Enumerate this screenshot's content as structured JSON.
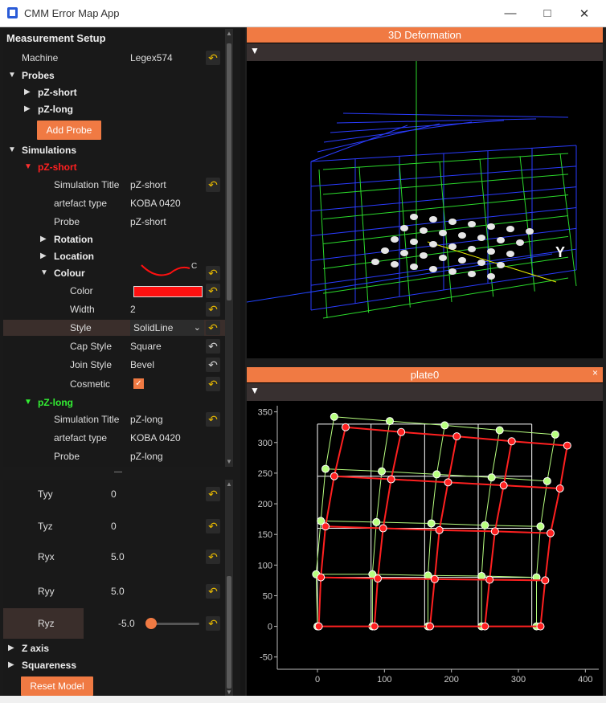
{
  "window": {
    "title": "CMM Error Map App"
  },
  "left_panel": {
    "heading": "Measurement Setup",
    "machine": {
      "label": "Machine",
      "value": "Legex574"
    },
    "probes": {
      "label": "Probes",
      "items": [
        "pZ-short",
        "pZ-long"
      ],
      "add_label": "Add Probe"
    },
    "simulations": {
      "label": "Simulations",
      "sim1": {
        "name": "pZ-short",
        "title_label": "Simulation Title",
        "title_value": "pZ-short",
        "artefact_label": "artefact type",
        "artefact_value": "KOBA 0420",
        "probe_label": "Probe",
        "probe_value": "pZ-short",
        "rotation_label": "Rotation",
        "location_label": "Location",
        "colour_label": "Colour",
        "color_label": "Color",
        "width_label": "Width",
        "width_value": "2",
        "style_label": "Style",
        "style_value": "SolidLine",
        "cap_label": "Cap Style",
        "cap_value": "Square",
        "join_label": "Join Style",
        "join_value": "Bevel",
        "cosmetic_label": "Cosmetic"
      },
      "sim2": {
        "name": "pZ-long",
        "title_label": "Simulation Title",
        "title_value": "pZ-long",
        "artefact_label": "artefact type",
        "artefact_value": "KOBA 0420",
        "probe_label": "Probe",
        "probe_value": "pZ-long"
      }
    }
  },
  "bottom_panel": {
    "tyy": {
      "label": "Tyy",
      "value": "0"
    },
    "tyz": {
      "label": "Tyz",
      "value": "0"
    },
    "ryx": {
      "label": "Ryx",
      "value": "5.0"
    },
    "ryy": {
      "label": "Ryy",
      "value": "5.0"
    },
    "ryz": {
      "label": "Ryz",
      "value": "-5.0"
    },
    "z_axis": "Z axis",
    "squareness": "Squareness",
    "reset_label": "Reset Model"
  },
  "dock_3d": {
    "title": "3D Deformation",
    "axis_label": "Y"
  },
  "dock_plate": {
    "title": "plate0"
  },
  "chart_data": {
    "type": "scatter",
    "title": "",
    "xlabel": "",
    "ylabel": "",
    "xlim": [
      -60,
      420
    ],
    "ylim": [
      -70,
      360
    ],
    "xticks": [
      0,
      100,
      200,
      300,
      400
    ],
    "yticks": [
      -50,
      0,
      50,
      100,
      150,
      200,
      250,
      300,
      350
    ],
    "grid_on": false,
    "series": [
      {
        "color": "#ffffff",
        "rows": [
          [
            [
              0,
              0
            ],
            [
              80,
              0
            ],
            [
              160,
              0
            ],
            [
              240,
              0
            ],
            [
              320,
              0
            ]
          ],
          [
            [
              0,
              80
            ],
            [
              80,
              80
            ],
            [
              160,
              80
            ],
            [
              240,
              80
            ],
            [
              320,
              80
            ]
          ],
          [
            [
              0,
              160
            ],
            [
              80,
              160
            ],
            [
              160,
              160
            ],
            [
              240,
              160
            ],
            [
              320,
              160
            ]
          ],
          [
            [
              0,
              245
            ],
            [
              80,
              245
            ],
            [
              160,
              245
            ],
            [
              240,
              245
            ],
            [
              320,
              245
            ]
          ],
          [
            [
              0,
              330
            ],
            [
              80,
              330
            ],
            [
              160,
              330
            ],
            [
              240,
              330
            ],
            [
              320,
              330
            ]
          ]
        ]
      },
      {
        "color": "#b8ff80",
        "rows": [
          [
            [
              0,
              0
            ],
            [
              82,
              0
            ],
            [
              165,
              0
            ],
            [
              245,
              0
            ],
            [
              327,
              0
            ]
          ],
          [
            [
              -2,
              85
            ],
            [
              82,
              85
            ],
            [
              165,
              83
            ],
            [
              245,
              82
            ],
            [
              327,
              80
            ]
          ],
          [
            [
              5,
              172
            ],
            [
              88,
              170
            ],
            [
              170,
              168
            ],
            [
              250,
              165
            ],
            [
              333,
              163
            ]
          ],
          [
            [
              12,
              257
            ],
            [
              96,
              253
            ],
            [
              178,
              248
            ],
            [
              260,
              243
            ],
            [
              343,
              237
            ]
          ],
          [
            [
              25,
              342
            ],
            [
              108,
              335
            ],
            [
              190,
              328
            ],
            [
              272,
              320
            ],
            [
              355,
              313
            ]
          ]
        ]
      },
      {
        "color": "#ff2020",
        "rows": [
          [
            [
              2,
              0
            ],
            [
              85,
              0
            ],
            [
              168,
              0
            ],
            [
              250,
              0
            ],
            [
              333,
              0
            ]
          ],
          [
            [
              5,
              80
            ],
            [
              90,
              78
            ],
            [
              175,
              77
            ],
            [
              257,
              76
            ],
            [
              340,
              75
            ]
          ],
          [
            [
              12,
              163
            ],
            [
              98,
              160
            ],
            [
              182,
              157
            ],
            [
              265,
              155
            ],
            [
              348,
              152
            ]
          ],
          [
            [
              25,
              245
            ],
            [
              110,
              240
            ],
            [
              195,
              235
            ],
            [
              278,
              230
            ],
            [
              362,
              225
            ]
          ],
          [
            [
              42,
              325
            ],
            [
              125,
              317
            ],
            [
              208,
              310
            ],
            [
              290,
              302
            ],
            [
              373,
              295
            ]
          ]
        ]
      }
    ]
  }
}
